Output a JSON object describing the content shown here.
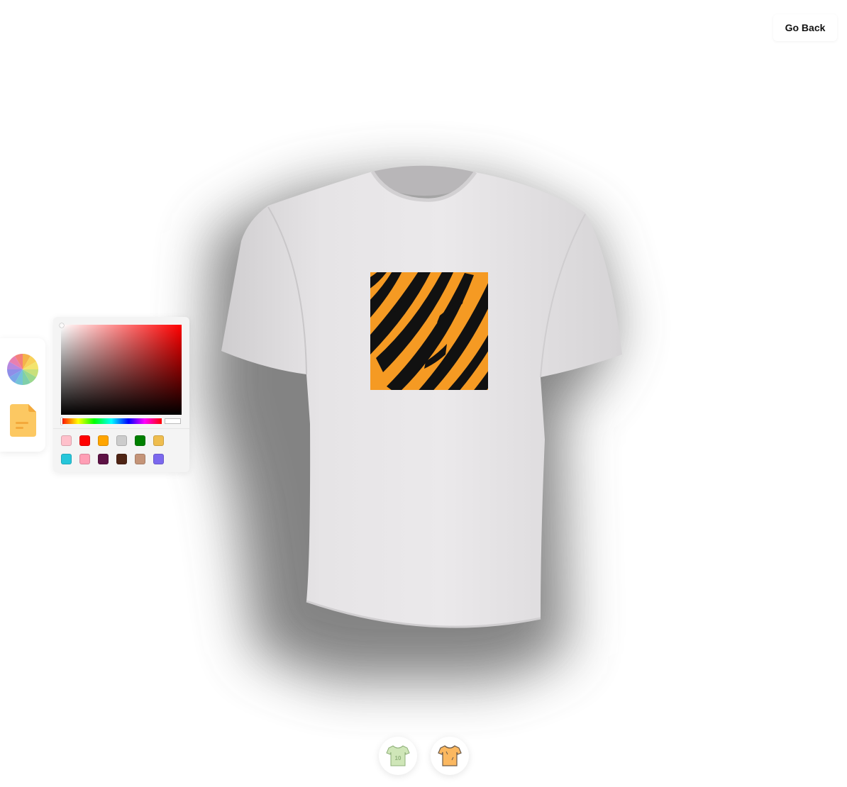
{
  "header": {
    "go_back_label": "Go Back"
  },
  "toolbar": {
    "items": [
      {
        "name": "color-wheel",
        "icon": "color-wheel-icon"
      },
      {
        "name": "file",
        "icon": "file-icon"
      }
    ]
  },
  "color_picker": {
    "selected_hue": "#ff0000",
    "preview_color": "#ffffff",
    "swatches": [
      "#ffc0cb",
      "#ff0000",
      "#ffa500",
      "#cccccc",
      "#008000",
      "#efbd4e",
      "#26c6da",
      "#ff9eb5",
      "#5d1245",
      "#4e2414",
      "#c49478",
      "#7b68ee"
    ]
  },
  "shirt": {
    "color": "#eeeeee",
    "decal": "tiger-stripes",
    "decal_colors": [
      "#f59a23",
      "#111111"
    ]
  },
  "bottom_tabs": [
    {
      "name": "logo-shirt",
      "icon": "logo-shirt-icon"
    },
    {
      "name": "stylish-shirt",
      "icon": "stylish-shirt-icon"
    }
  ]
}
